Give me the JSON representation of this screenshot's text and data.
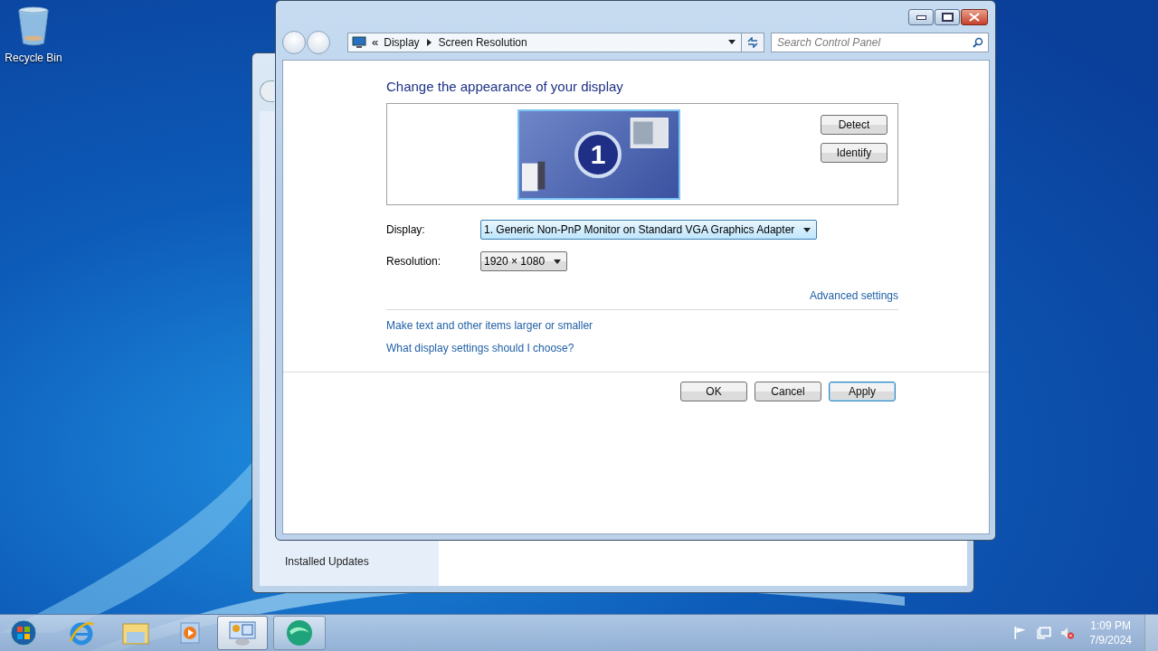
{
  "desktop_icons": [
    {
      "label": "Recycle Bin"
    }
  ],
  "back_window": {
    "sidebar_items": [
      "Installed Updates"
    ]
  },
  "window": {
    "address_overflow": "«",
    "breadcrumb": [
      "Display",
      "Screen Resolution"
    ],
    "search": {
      "placeholder": "Search Control Panel"
    },
    "heading": "Change the appearance of your display",
    "monitor_number": "1",
    "side_buttons": [
      "Detect",
      "Identify"
    ],
    "fields": [
      {
        "label": "Display:",
        "value": "1. Generic Non-PnP Monitor on Standard VGA Graphics Adapter",
        "focused": true
      },
      {
        "label": "Resolution:",
        "value": "1920 × 1080",
        "focused": false
      }
    ],
    "advanced_link": "Advanced settings",
    "links": [
      "Make text and other items larger or smaller",
      "What display settings should I choose?"
    ],
    "buttons": [
      {
        "label": "OK",
        "default": false
      },
      {
        "label": "Cancel",
        "default": false
      },
      {
        "label": "Apply",
        "default": true
      }
    ]
  },
  "taskbar": {
    "apps": [
      {
        "running": false,
        "selected": false
      },
      {
        "running": false,
        "selected": false
      },
      {
        "running": false,
        "selected": false
      },
      {
        "running": true,
        "selected": true
      },
      {
        "running": true,
        "selected": false
      }
    ]
  },
  "tray": {
    "time": "1:09 PM",
    "date": "7/9/2024"
  }
}
